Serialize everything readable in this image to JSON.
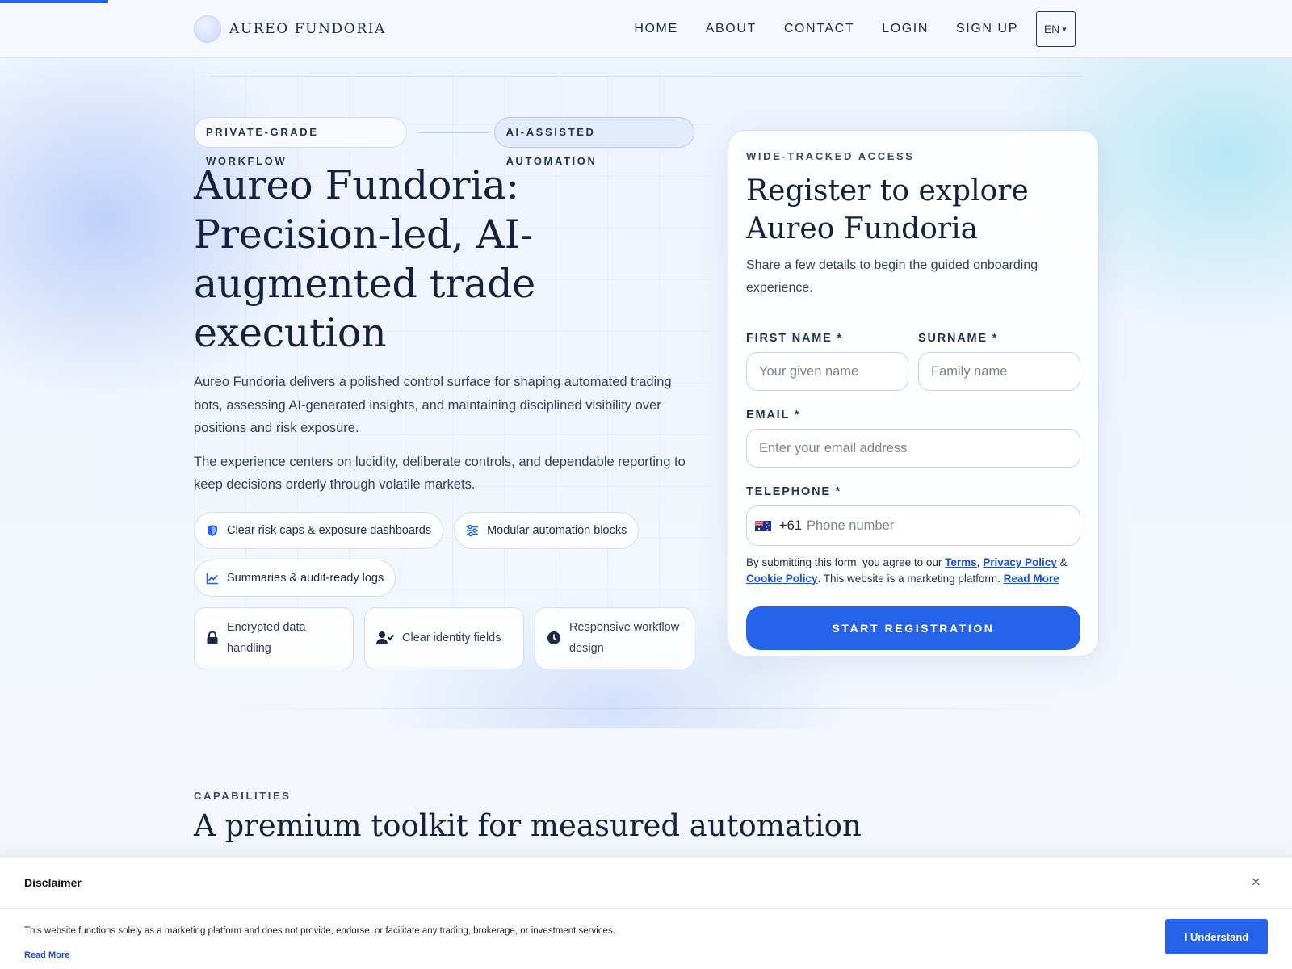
{
  "page": {
    "reading_progress": 0.084
  },
  "header": {
    "brand": "AUREO FUNDORIA",
    "nav": [
      "HOME",
      "ABOUT",
      "CONTACT",
      "LOGIN",
      "SIGN UP"
    ],
    "language": "EN"
  },
  "hero": {
    "tags": [
      "PRIVATE-GRADE WORKFLOW",
      "AI-ASSISTED AUTOMATION"
    ],
    "title": "Aureo Fundoria: Precision-led, AI-augmented trade execution",
    "paragraphs": [
      "Aureo Fundoria delivers a polished control surface for shaping automated trading bots, assessing AI-generated insights, and maintaining disciplined visibility over positions and risk exposure.",
      "The experience centers on lucidity, deliberate controls, and dependable reporting to keep decisions orderly through volatile markets."
    ],
    "chips": [
      {
        "label": "Clear risk caps & exposure dashboards",
        "icon": "shield-icon"
      },
      {
        "label": "Modular automation blocks",
        "icon": "sliders-icon"
      },
      {
        "label": "Summaries & audit-ready logs",
        "icon": "chart-line-icon"
      }
    ],
    "features": [
      {
        "label": "Encrypted data handling",
        "icon": "lock-icon"
      },
      {
        "label": "Clear identity fields",
        "icon": "user-check-icon"
      },
      {
        "label": "Responsive workflow design",
        "icon": "clock-icon"
      }
    ]
  },
  "form": {
    "eyebrow": "WIDE-TRACKED ACCESS",
    "title": "Register to explore Aureo Fundoria",
    "subtitle": "Share a few details to begin the guided onboarding experience.",
    "first_name": {
      "label": "FIRST NAME *",
      "placeholder": "Your given name",
      "value": ""
    },
    "surname": {
      "label": "SURNAME *",
      "placeholder": "Family name",
      "value": ""
    },
    "email": {
      "label": "EMAIL *",
      "placeholder": "Enter your email address",
      "value": ""
    },
    "telephone": {
      "label": "TELEPHONE *",
      "dial_code": "+61",
      "country_flag": "australia-flag-icon",
      "placeholder": "Phone number",
      "value": ""
    },
    "consent": {
      "prefix": "By submitting this form, you agree to our",
      "terms": "Terms",
      "comma": ",",
      "privacy": "Privacy Policy",
      "amp": "&",
      "cookie": "Cookie Policy",
      "suffix": ". This website is a marketing platform.",
      "read_more": "Read More"
    },
    "submit": "START REGISTRATION"
  },
  "capabilities": {
    "eyebrow": "CAPABILITIES",
    "title": "A premium toolkit for measured automation"
  },
  "disclaimer": {
    "title": "Disclaimer",
    "close": "×",
    "text": "This website functions solely as a marketing platform and does not provide, endorse, or facilitate any trading, brokerage, or investment services.",
    "read_more": "Read More",
    "button": "I Understand"
  },
  "colors": {
    "accent": "#2563eb",
    "link": "#1d4ed8",
    "heading": "#15223d",
    "body_text": "#34415d"
  }
}
